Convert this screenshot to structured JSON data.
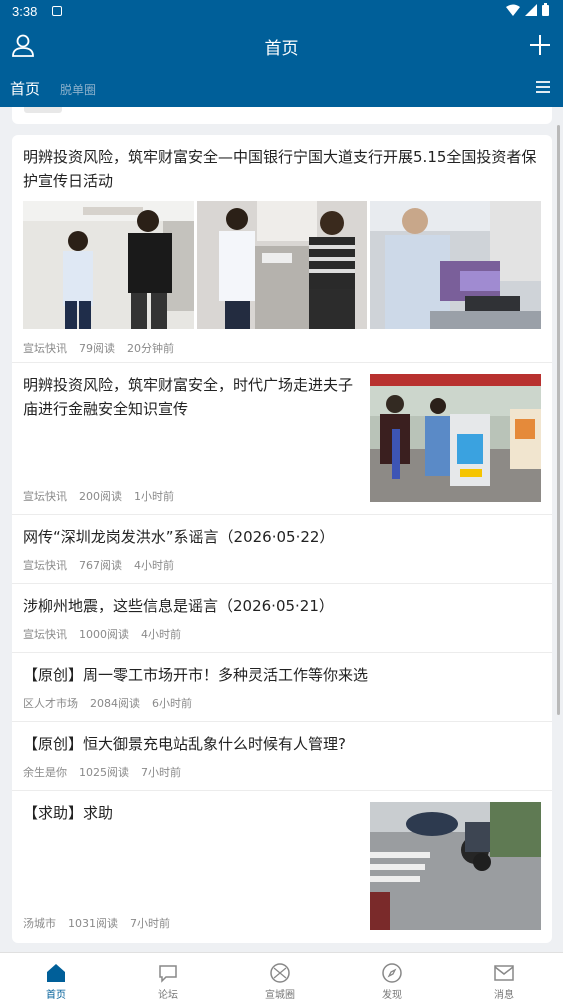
{
  "status": {
    "time": "3:38"
  },
  "header": {
    "title": "首页"
  },
  "tabs": [
    {
      "label": "首页"
    },
    {
      "label": "脱单圈"
    }
  ],
  "feed": [
    {
      "title": "明辨投资风险，筑牢财富安全—中国银行宁国大道支行开展5.15全国投资者保护宣传日活动",
      "source": "宣坛快讯",
      "reads": "79阅读",
      "time": "20分钟前"
    },
    {
      "title": "明辨投资风险，筑牢财富安全，时代广场走进夫子庙进行金融安全知识宣传",
      "source": "宣坛快讯",
      "reads": "200阅读",
      "time": "1小时前"
    },
    {
      "title": "网传“深圳龙岗发洪水”系谣言（2026·05·22）",
      "source": "宣坛快讯",
      "reads": "767阅读",
      "time": "4小时前"
    },
    {
      "title": "涉柳州地震，这些信息是谣言（2026·05·21）",
      "source": "宣坛快讯",
      "reads": "1000阅读",
      "time": "4小时前"
    },
    {
      "title": "【原创】周一零工市场开市！多种灵活工作等你来选",
      "source": "区人才市场",
      "reads": "2084阅读",
      "time": "6小时前"
    },
    {
      "title": "【原创】恒大御景充电站乱象什么时候有人管理?",
      "source": "余生是你",
      "reads": "1025阅读",
      "time": "7小时前"
    },
    {
      "title": "【求助】求助",
      "source": "汤城市",
      "reads": "1031阅读",
      "time": "7小时前"
    }
  ],
  "bottom_nav": [
    {
      "label": "首页",
      "icon": "home-icon"
    },
    {
      "label": "论坛",
      "icon": "chat-bubble-icon"
    },
    {
      "label": "宣城圈",
      "icon": "circle-icon"
    },
    {
      "label": "发现",
      "icon": "compass-icon"
    },
    {
      "label": "消息",
      "icon": "mail-icon"
    }
  ],
  "colors": {
    "primary": "#005f99",
    "background": "#eef0f3"
  }
}
